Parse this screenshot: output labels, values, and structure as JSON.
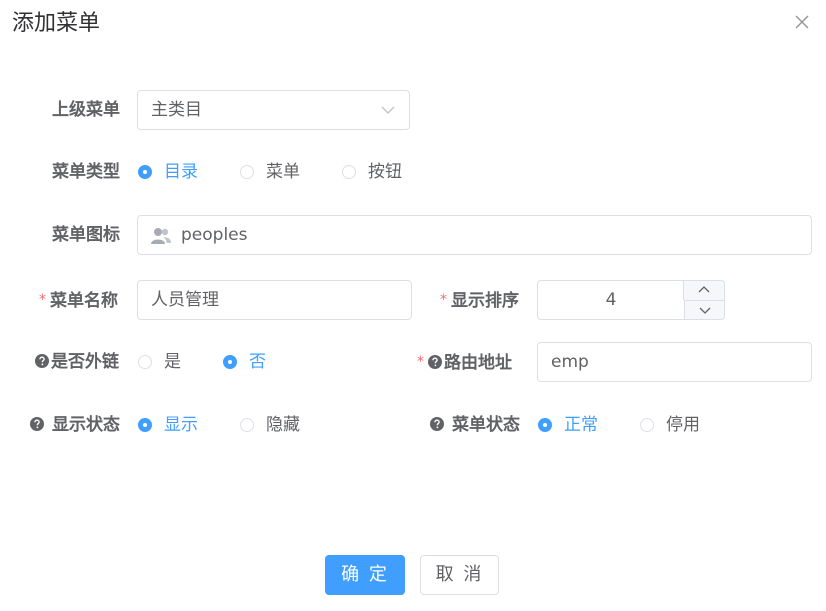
{
  "dialog": {
    "title": "添加菜单"
  },
  "form": {
    "parent": {
      "label": "上级菜单",
      "value": "主类目"
    },
    "menu_type": {
      "label": "菜单类型",
      "options": [
        "目录",
        "菜单",
        "按钮"
      ],
      "selected": "目录"
    },
    "icon": {
      "label": "菜单图标",
      "value": "peoples"
    },
    "menu_name": {
      "label": "菜单名称",
      "value": "人员管理",
      "required_mark": "*"
    },
    "sort_order": {
      "label": "显示排序",
      "value": "4",
      "required_mark": "*"
    },
    "is_external": {
      "label": "是否外链",
      "options": [
        "是",
        "否"
      ],
      "selected": "否"
    },
    "route_path": {
      "label": "路由地址",
      "value": "emp",
      "required_mark": "*"
    },
    "visible": {
      "label": "显示状态",
      "options": [
        "显示",
        "隐藏"
      ],
      "selected": "显示"
    },
    "status": {
      "label": "菜单状态",
      "options": [
        "正常",
        "停用"
      ],
      "selected": "正常"
    }
  },
  "footer": {
    "confirm_label": "确 定",
    "cancel_label": "取 消"
  },
  "colors": {
    "primary": "#409eff",
    "danger": "#f56c6c",
    "text": "#606266",
    "border": "#dcdfe6"
  },
  "icons": {
    "close": "close-icon",
    "dropdown": "chevron-down-icon",
    "menu_icon": "people-icon",
    "help": "question-circle-icon",
    "increase": "chevron-up-icon",
    "decrease": "chevron-down-icon"
  }
}
